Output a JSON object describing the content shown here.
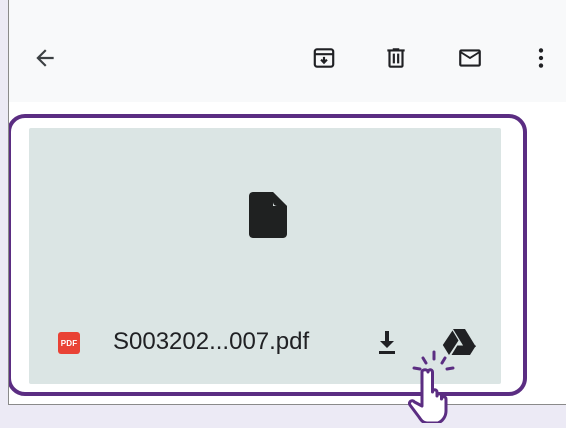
{
  "topbar": {
    "icons": [
      "back-arrow-icon",
      "archive-icon",
      "delete-icon",
      "mail-icon",
      "more-vert-icon"
    ]
  },
  "attachment": {
    "filename": "S003202...007.pdf",
    "badge_label": "PDF",
    "actions": [
      "download-icon",
      "google-drive-icon"
    ]
  },
  "colors": {
    "highlight": "#5b2d82",
    "card_background": "#dbe5e4",
    "pdf_badge": "#e94235"
  }
}
